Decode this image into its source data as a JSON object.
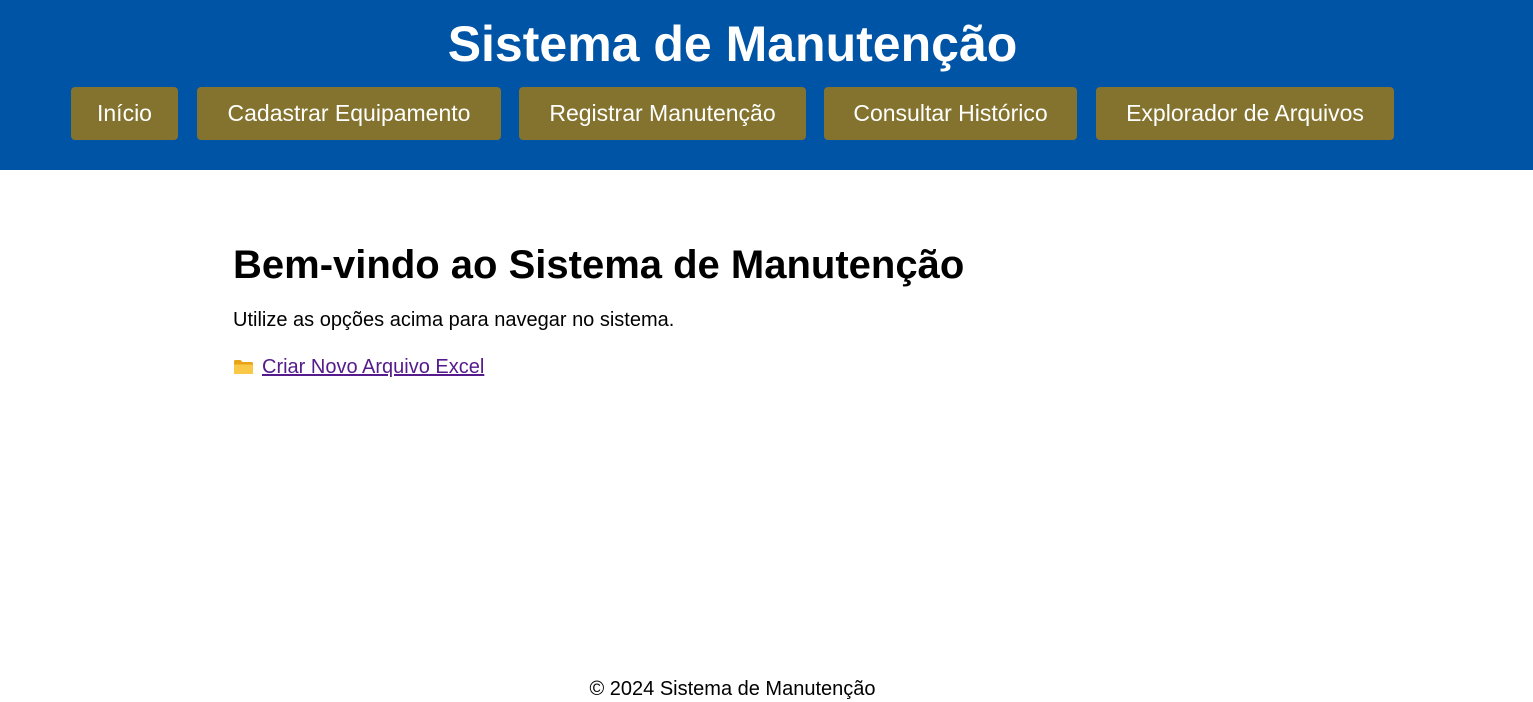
{
  "header": {
    "title": "Sistema de Manutenção"
  },
  "nav": {
    "items": [
      {
        "label": "Início"
      },
      {
        "label": "Cadastrar Equipamento"
      },
      {
        "label": "Registrar Manutenção"
      },
      {
        "label": "Consultar Histórico"
      },
      {
        "label": "Explorador de Arquivos"
      }
    ]
  },
  "main": {
    "heading": "Bem-vindo ao Sistema de Manutenção",
    "intro": "Utilize as opções acima para navegar no sistema.",
    "link": {
      "icon": "folder-icon",
      "label": "Criar Novo Arquivo Excel"
    }
  },
  "footer": {
    "text": "© 2024 Sistema de Manutenção"
  },
  "colors": {
    "header_bg": "#0054a6",
    "nav_button_bg": "#83732e",
    "link": "#551a8b"
  }
}
